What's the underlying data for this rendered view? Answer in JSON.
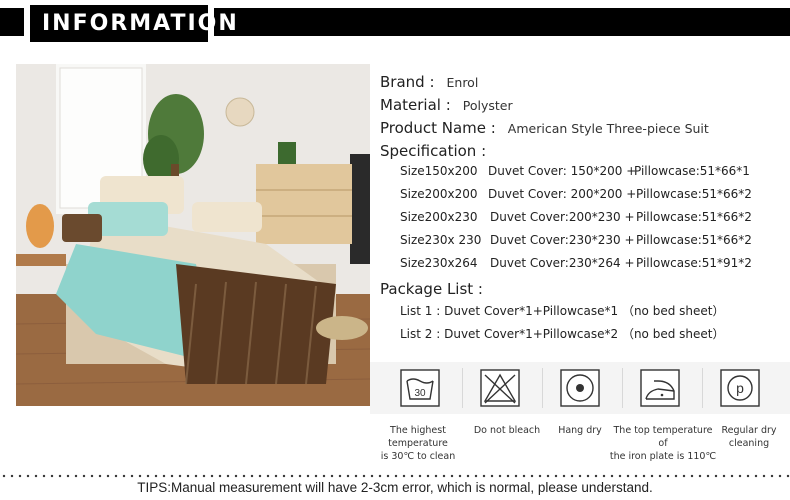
{
  "header": {
    "title": "INFORMATION"
  },
  "specs": {
    "brand_label": "Brand :",
    "brand_value": "Enrol",
    "material_label": "Material :",
    "material_value": "Polyster",
    "product_label": "Product Name :",
    "product_value": "American Style Three-piece Suit",
    "spec_label": "Specification :",
    "sizes": [
      {
        "size": "Size150x200",
        "duvet": "Duvet Cover: 150*200 +",
        "pillow": "Pillowcase:51*66*1"
      },
      {
        "size": "Size200x200",
        "duvet": "Duvet Cover: 200*200  +",
        "pillow": "Pillowcase:51*66*2"
      },
      {
        "size": "Size200x230",
        "duvet": "Duvet Cover:200*230  +",
        "pillow": "Pillowcase:51*66*2"
      },
      {
        "size": "Size230x 230",
        "duvet": "Duvet Cover:230*230  +",
        "pillow": "Pillowcase:51*66*2"
      },
      {
        "size": "Size230x264",
        "duvet": "Duvet Cover:230*264  +",
        "pillow": "Pillowcase:51*91*2"
      }
    ],
    "package_label": "Package List :",
    "packages": [
      "List 1 : Duvet Cover*1+Pillowcase*1 （no bed sheet）",
      "List 2 : Duvet Cover*1+Pillowcase*2 （no bed sheet）"
    ]
  },
  "care": [
    {
      "icon": "wash-30-icon",
      "wash_temp": "30",
      "label1": "The highest temperature",
      "label2": "is 30℃ to clean"
    },
    {
      "icon": "do-not-bleach-icon",
      "label1": "Do not bleach",
      "label2": ""
    },
    {
      "icon": "hang-dry-icon",
      "label1": "Hang dry",
      "label2": ""
    },
    {
      "icon": "iron-110-icon",
      "label1": "The top temperature of",
      "label2": "the iron plate is 110℃"
    },
    {
      "icon": "dry-clean-icon",
      "dry_clean_letter": "p",
      "label1": "Regular dry",
      "label2": "cleaning"
    }
  ],
  "footer": {
    "tips": "TIPS:Manual measurement will have 2-3cm error, which is normal, please understand."
  }
}
